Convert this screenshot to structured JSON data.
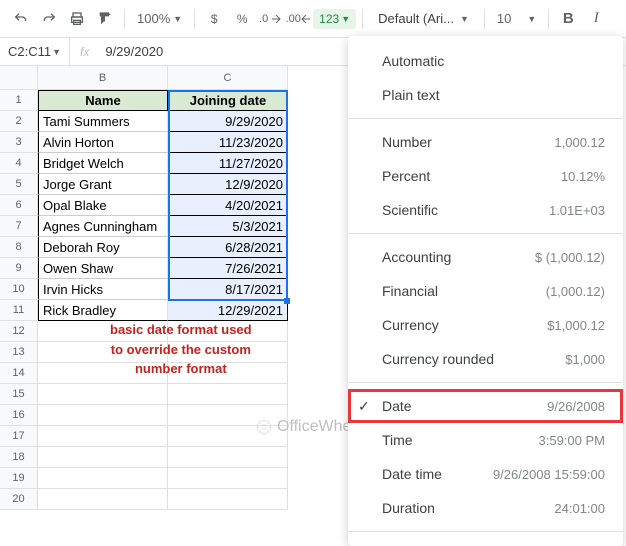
{
  "toolbar": {
    "zoom": "100%",
    "currency": "$",
    "percent": "%",
    "dec_dec": ".0",
    "inc_dec": ".00",
    "format_btn": "123",
    "font": "Default (Ari...",
    "font_size": "10",
    "bold": "B",
    "italic": "I"
  },
  "formula_bar": {
    "ref": "C2:C11",
    "fx": "fx",
    "value": "9/29/2020"
  },
  "columns": [
    "B",
    "C"
  ],
  "rows": [
    "1",
    "2",
    "3",
    "4",
    "5",
    "6",
    "7",
    "8",
    "9",
    "10",
    "11",
    "12",
    "13",
    "14",
    "15",
    "16",
    "17",
    "18",
    "19",
    "20"
  ],
  "headers": {
    "b": "Name",
    "c": "Joining date"
  },
  "data": [
    {
      "name": "Tami Summers",
      "date": "9/29/2020"
    },
    {
      "name": "Alvin Horton",
      "date": "11/23/2020"
    },
    {
      "name": "Bridget Welch",
      "date": "11/27/2020"
    },
    {
      "name": "Jorge Grant",
      "date": "12/9/2020"
    },
    {
      "name": "Opal Blake",
      "date": "4/20/2021"
    },
    {
      "name": "Agnes Cunningham",
      "date": "5/3/2021"
    },
    {
      "name": "Deborah Roy",
      "date": "6/28/2021"
    },
    {
      "name": "Owen Shaw",
      "date": "7/26/2021"
    },
    {
      "name": "Irvin Hicks",
      "date": "8/17/2021"
    },
    {
      "name": "Rick Bradley",
      "date": "12/29/2021"
    }
  ],
  "annotation": "basic date format used\nto override the custom\nnumber format",
  "watermark": "OfficeWheel",
  "dropdown": {
    "automatic": "Automatic",
    "plain": "Plain text",
    "number": {
      "label": "Number",
      "sample": "1,000.12"
    },
    "percent": {
      "label": "Percent",
      "sample": "10.12%"
    },
    "scientific": {
      "label": "Scientific",
      "sample": "1.01E+03"
    },
    "accounting": {
      "label": "Accounting",
      "sample": "$ (1,000.12)"
    },
    "financial": {
      "label": "Financial",
      "sample": "(1,000.12)"
    },
    "currency": {
      "label": "Currency",
      "sample": "$1,000.12"
    },
    "currency_rounded": {
      "label": "Currency rounded",
      "sample": "$1,000"
    },
    "date": {
      "label": "Date",
      "sample": "9/26/2008"
    },
    "time": {
      "label": "Time",
      "sample": "3:59:00 PM"
    },
    "datetime": {
      "label": "Date time",
      "sample": "9/26/2008 15:59:00"
    },
    "duration": {
      "label": "Duration",
      "sample": "24:01:00"
    }
  }
}
